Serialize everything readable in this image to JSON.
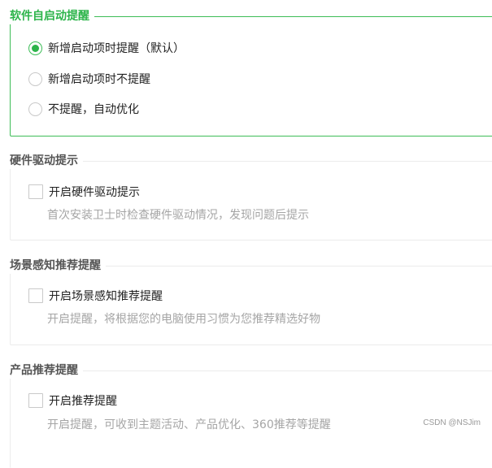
{
  "startup": {
    "title": "软件自启动提醒",
    "options": [
      {
        "label": "新增启动项时提醒（默认）",
        "checked": true
      },
      {
        "label": "新增启动项时不提醒",
        "checked": false
      },
      {
        "label": "不提醒，自动优化",
        "checked": false
      }
    ]
  },
  "hardware": {
    "title": "硬件驱动提示",
    "checkbox_label": "开启硬件驱动提示",
    "checked": false,
    "description": "首次安装卫士时检查硬件驱动情况，发现问题后提示"
  },
  "scene": {
    "title": "场景感知推荐提醒",
    "checkbox_label": "开启场景感知推荐提醒",
    "checked": false,
    "description": "开启提醒，将根据您的电脑使用习惯为您推荐精选好物"
  },
  "product": {
    "title": "产品推荐提醒",
    "checkbox_label": "开启推荐提醒",
    "checked": false,
    "description": "开启提醒，可收到主题活动、产品优化、360推荐等提醒"
  },
  "watermark": "CSDN @NSJim",
  "colors": {
    "accent": "#2cb44a",
    "border": "#ececec",
    "muted_text": "#a5a5a5"
  }
}
